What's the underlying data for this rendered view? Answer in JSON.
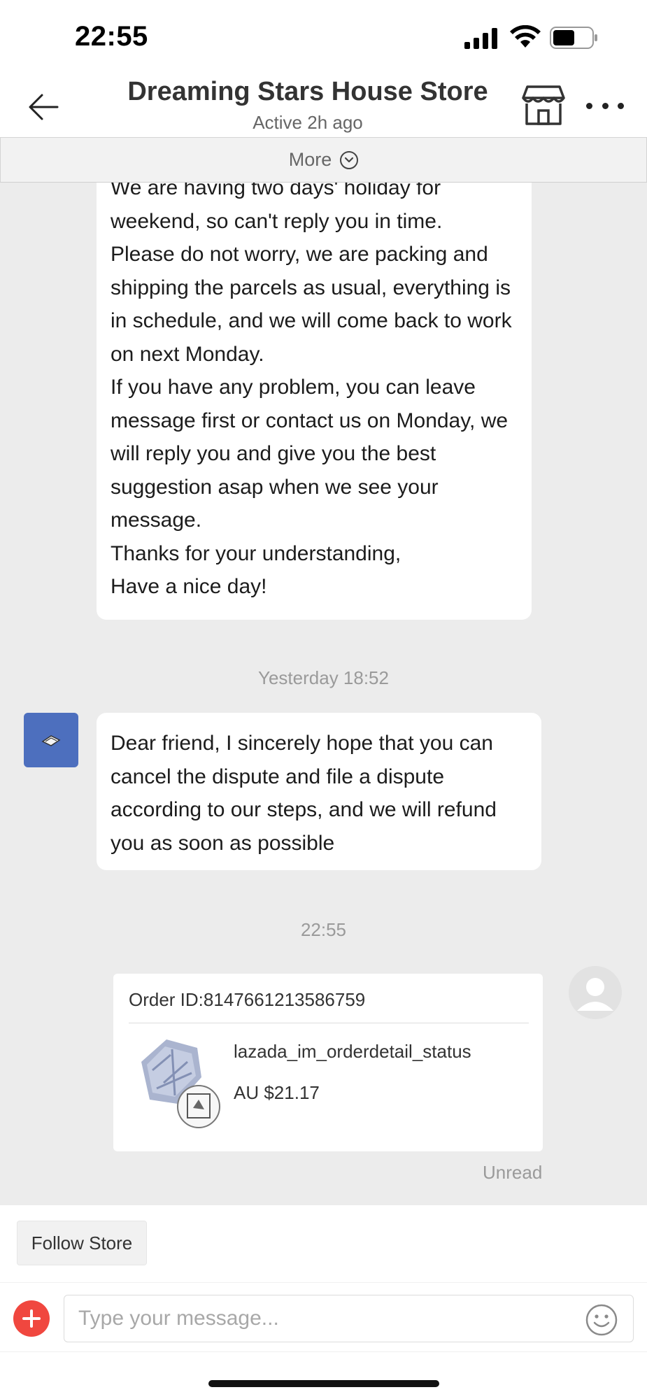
{
  "status_bar": {
    "time": "22:55"
  },
  "header": {
    "store_name": "Dreaming Stars House Store",
    "active_status": "Active 2h ago"
  },
  "more_bar": {
    "label": "More"
  },
  "messages": [
    {
      "from": "seller",
      "text": "We are having two days' holiday for weekend, so can't reply you in time.\nPlease do not worry, we are packing and shipping the parcels as usual, everything is in schedule, and we will come back to work on next Monday.\nIf you have any problem, you can leave message first or contact us on Monday, we will reply you and give you the best suggestion asap when we see your message.\nThanks for your understanding,\nHave a nice day!"
    },
    {
      "from": "seller",
      "timestamp": "Yesterday 18:52",
      "text": "Dear friend, I sincerely hope that you can cancel the dispute and file a dispute according to our steps, and we will refund you as soon as possible"
    }
  ],
  "order_message": {
    "timestamp": "22:55",
    "order_id": "Order ID:8147661213586759",
    "status": "lazada_im_orderdetail_status",
    "price": "AU $21.17",
    "read_status": "Unread"
  },
  "bottom": {
    "follow_label": "Follow Store",
    "input_placeholder": "Type your message..."
  },
  "colors": {
    "chat_background": "#ececec",
    "plus_button": "#f0473f",
    "seller_avatar": "#4d6fbe"
  }
}
